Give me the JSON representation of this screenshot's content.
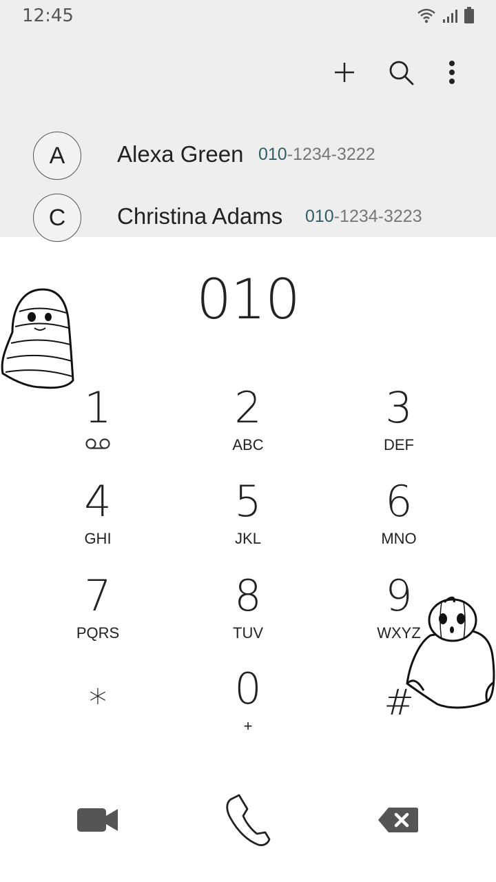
{
  "status_bar": {
    "time": "12:45",
    "icons": [
      "wifi-icon",
      "signal-icon",
      "battery-icon"
    ]
  },
  "toolbar": {
    "icons": [
      "add-icon",
      "search-icon",
      "more-vert-icon"
    ]
  },
  "contacts": [
    {
      "initial": "A",
      "name": "Alexa Green",
      "number_match": "010",
      "number_rest": "-1234-3222"
    },
    {
      "initial": "C",
      "name": "Christina Adams",
      "number_match": "010",
      "number_rest": "-1234-3223"
    }
  ],
  "dialer": {
    "entered_number": "010",
    "keys": [
      {
        "digit": "1",
        "letters": ""
      },
      {
        "digit": "2",
        "letters": "ABC"
      },
      {
        "digit": "3",
        "letters": "DEF"
      },
      {
        "digit": "4",
        "letters": "GHI"
      },
      {
        "digit": "5",
        "letters": "JKL"
      },
      {
        "digit": "6",
        "letters": "MNO"
      },
      {
        "digit": "7",
        "letters": "PQRS"
      },
      {
        "digit": "8",
        "letters": "TUV"
      },
      {
        "digit": "9",
        "letters": "WXYZ"
      },
      {
        "digit": "*",
        "letters": ""
      },
      {
        "digit": "0",
        "letters": "+"
      },
      {
        "digit": "#",
        "letters": ""
      }
    ]
  },
  "actions": [
    "video-call-icon",
    "call-icon",
    "backspace-icon"
  ],
  "colors": {
    "top_background": "#eeeeee",
    "highlight_number": "#2f5f66",
    "action_icon": "#555555"
  }
}
